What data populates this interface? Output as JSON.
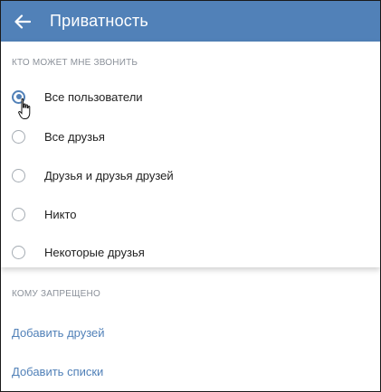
{
  "header": {
    "back_icon": "arrow-left-icon",
    "title": "Приватность",
    "color": "#5181b8"
  },
  "who_can_call": {
    "section_label": "КТО МОЖЕТ МНЕ ЗВОНИТЬ",
    "options": [
      {
        "label": "Все пользователи",
        "selected": true
      },
      {
        "label": "Все друзья",
        "selected": false
      },
      {
        "label": "Друзья и друзья друзей",
        "selected": false
      },
      {
        "label": "Никто",
        "selected": false
      },
      {
        "label": "Некоторые друзья",
        "selected": false
      }
    ]
  },
  "forbidden": {
    "section_label": "КОМУ ЗАПРЕЩЕНО",
    "add_friends_label": "Добавить друзей",
    "add_lists_label": "Добавить списки"
  },
  "accent_color": "#5181b8"
}
